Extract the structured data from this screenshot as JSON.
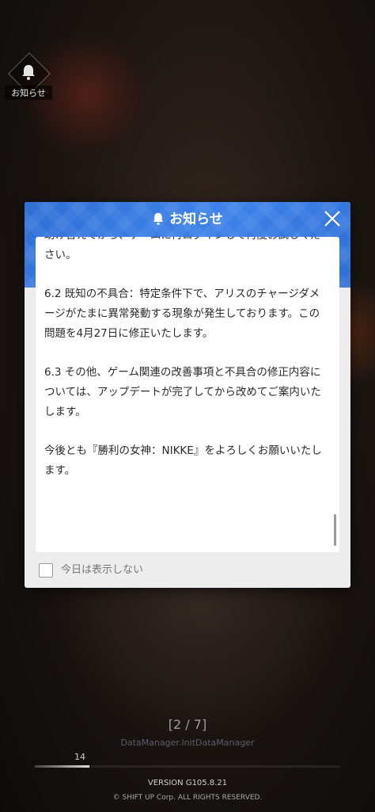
{
  "notice_badge": {
    "label": "お知らせ"
  },
  "modal": {
    "title": "お知らせ",
    "paragraphs": [
      "助け合えてから、ゲームに再ログインして再度お試しください。",
      "6.2 既知の不具合：特定条件下で、アリスのチャージダメージがたまに異常発動する現象が発生しております。この問題を4月27日に修正いたします。",
      "6.3 その他、ゲーム関連の改善事項と不具合の修正内容については、アップデートが完了してから改めてご案内いたします。",
      "今後とも『勝利の女神：NIKKE』をよろしくお願いいたします。"
    ],
    "dont_show_today": "今日は表示しない"
  },
  "loading": {
    "page_indicator": "[2 / 7]",
    "status_text": "DataManager.InitDataManager",
    "progress_value": "14",
    "progress_fraction": 0.18
  },
  "footer": {
    "version": "VERSION  G105.8.21",
    "copyright": "© SHIFT UP Corp. ALL RIGHTS RESERVED."
  },
  "colors": {
    "header_blue": "#3d82ea",
    "card_bg": "#ffffff",
    "modal_bg": "#ededed"
  },
  "icons": {
    "badge": "bell-icon",
    "title": "bell-icon",
    "close": "close-icon"
  }
}
